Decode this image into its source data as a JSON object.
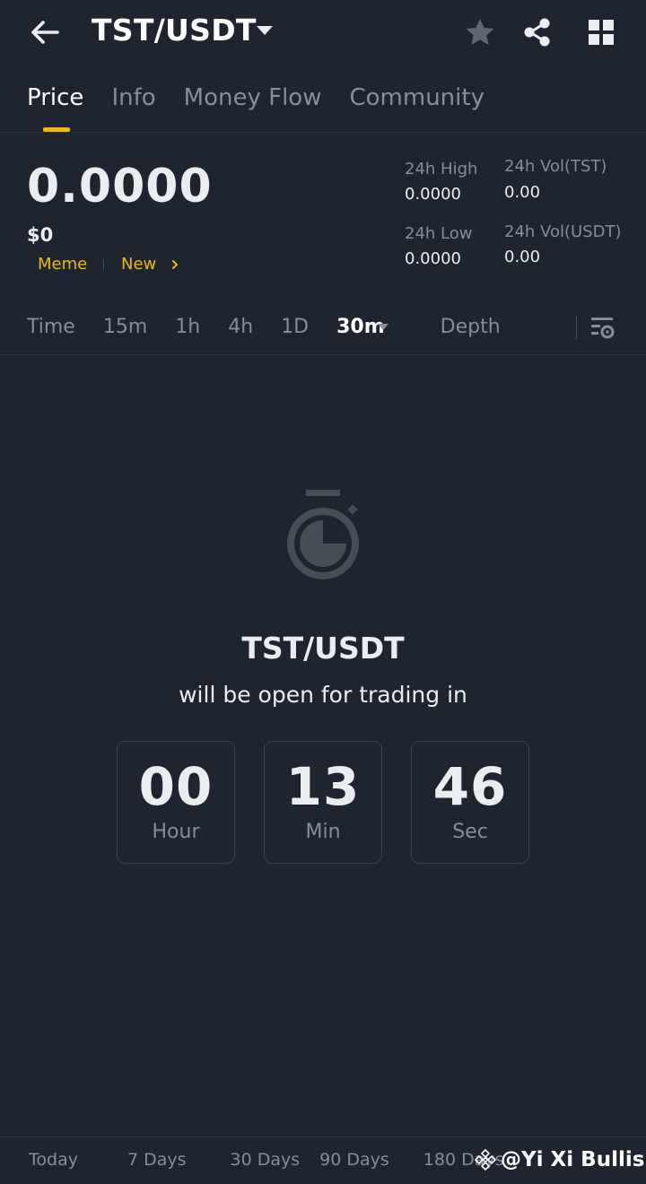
{
  "header": {
    "pair": "TST/USDT",
    "icons": [
      "back-arrow-icon",
      "caret-down-icon",
      "star-icon",
      "share-icon",
      "grid-icon"
    ]
  },
  "tabs": [
    {
      "label": "Price",
      "active": true
    },
    {
      "label": "Info",
      "active": false
    },
    {
      "label": "Money Flow",
      "active": false
    },
    {
      "label": "Community",
      "active": false
    }
  ],
  "price": {
    "last": "0.0000",
    "usd": "$0",
    "tags": [
      "Meme",
      "New"
    ]
  },
  "stats": {
    "high_label": "24h High",
    "high_value": "0.0000",
    "low_label": "24h Low",
    "low_value": "0.0000",
    "vol_base_label": "24h Vol(TST)",
    "vol_base_value": "0.00",
    "vol_quote_label": "24h Vol(USDT)",
    "vol_quote_value": "0.00"
  },
  "intervals": {
    "items": [
      "Time",
      "15m",
      "1h",
      "4h",
      "1D"
    ],
    "selected": "30m",
    "depth": "Depth"
  },
  "countdown": {
    "pair": "TST/USDT",
    "message": "will be open for trading in",
    "hours": "00",
    "hours_label": "Hour",
    "minutes": "13",
    "minutes_label": "Min",
    "seconds": "46",
    "seconds_label": "Sec"
  },
  "bottom_bar": {
    "periods": [
      "Today",
      "7 Days",
      "30 Days",
      "90 Days",
      "180 Days"
    ]
  },
  "watermark": "@Yi Xi Bullish",
  "colors": {
    "background": "#1f2530",
    "accent": "#f0b90b",
    "text_primary": "#eaecef",
    "text_secondary": "#848e9c"
  }
}
